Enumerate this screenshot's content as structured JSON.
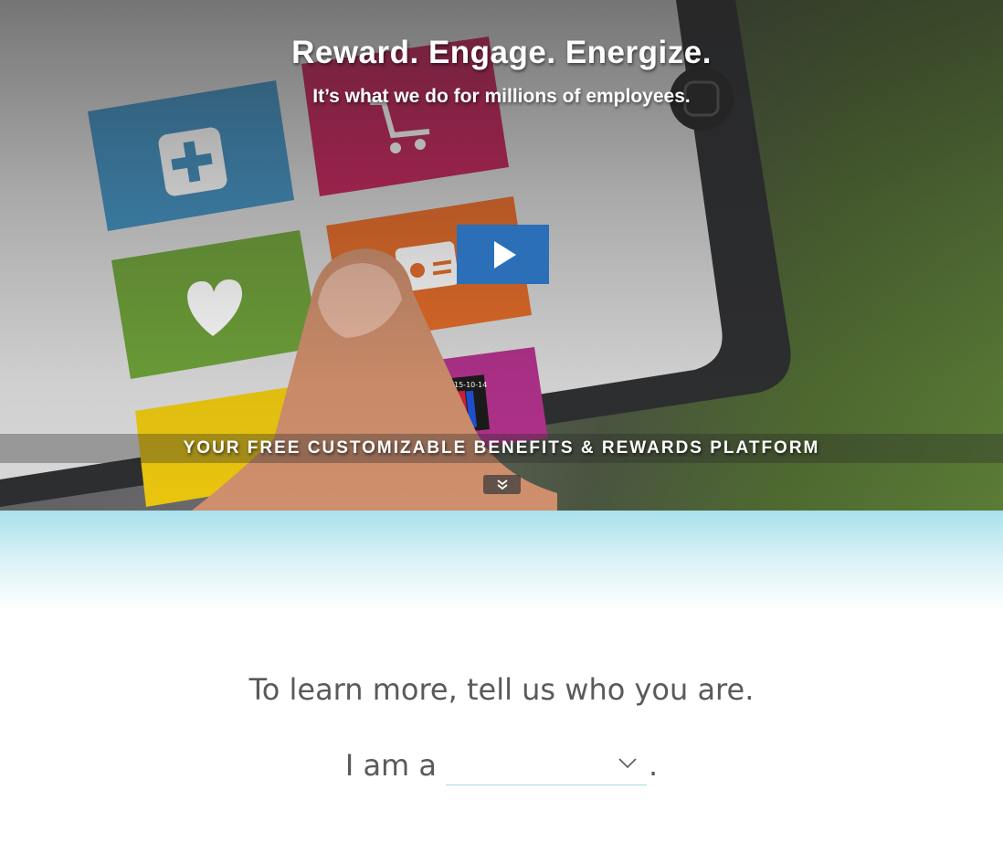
{
  "hero": {
    "title": "Reward. Engage. Energize.",
    "subtitle": "It’s what we do for millions of employees.",
    "video": {
      "play_icon": "play-icon",
      "button_color": "#2a6fb8"
    },
    "background": {
      "description_icons": [
        "medical-kit-icon",
        "shopping-cart-icon",
        "heart-icon",
        "id-badge-icon",
        "calendar-icon",
        "hand-finger"
      ],
      "tablet_date_label": "15-10-14"
    },
    "banner_text": "YOUR FREE CUSTOMIZABLE BENEFITS & REWARDS PLATFORM",
    "scroll_icon": "double-chevron-down-icon"
  },
  "learn_more": {
    "heading": "To learn more, tell us who you are.",
    "prefix": "I am a",
    "suffix": ".",
    "role_select": {
      "selected": "",
      "icon": "chevron-down-icon",
      "underline_color": "#a8d8e4"
    }
  }
}
